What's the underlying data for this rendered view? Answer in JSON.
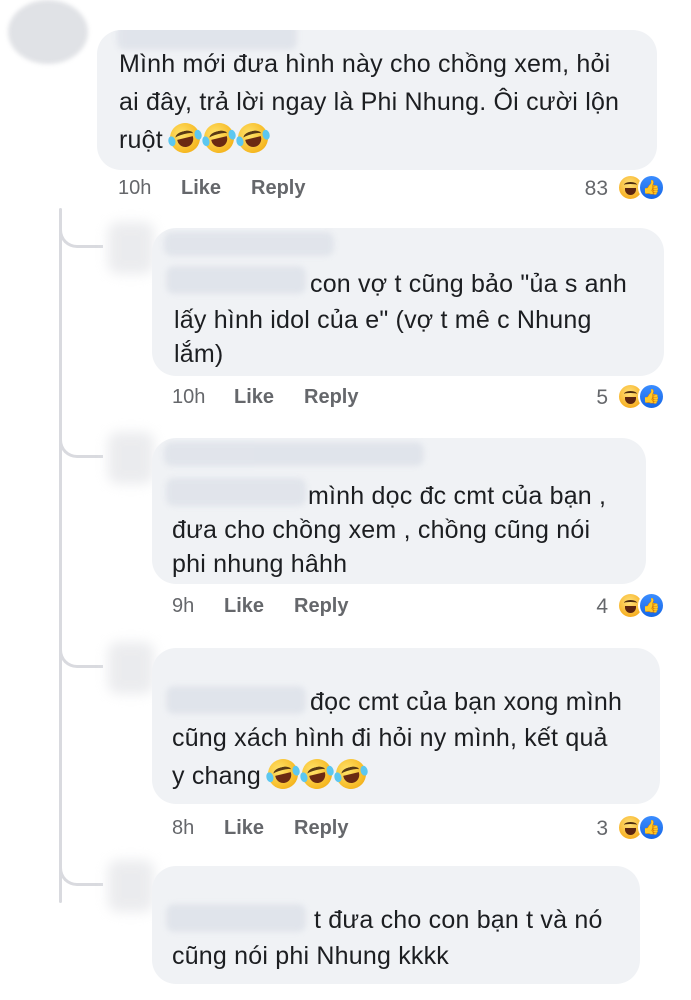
{
  "comments": [
    {
      "text_line_1": "Mình mới đưa hình này cho chồng xem, hỏi",
      "text_line_2": "ai đây, trả lời ngay là Phi Nhung. Ôi cười lộn",
      "text_line_3": "ruột",
      "emoji_icon": "rolling-on-floor-laughing-emoji",
      "emoji_count": 3,
      "time": "10h",
      "like_label": "Like",
      "reply_label": "Reply",
      "reaction_count": "83",
      "reaction_icons": [
        "haha-reaction-icon",
        "like-reaction-icon"
      ]
    },
    {
      "text_line_1": "con vợ t cũng bảo \"ủa s anh",
      "text_line_2": "lấy hình idol của e\" (vợ t mê c Nhung",
      "text_line_3": "lắm)",
      "time": "10h",
      "like_label": "Like",
      "reply_label": "Reply",
      "reaction_count": "5",
      "reaction_icons": [
        "haha-reaction-icon",
        "like-reaction-icon"
      ]
    },
    {
      "text_line_1": "mình dọc đc cmt của bạn ,",
      "text_line_2": "đưa cho chồng xem , chồng cũng nói",
      "text_line_3": "phi nhung hâhh",
      "time": "9h",
      "like_label": "Like",
      "reply_label": "Reply",
      "reaction_count": "4",
      "reaction_icons": [
        "haha-reaction-icon",
        "like-reaction-icon"
      ]
    },
    {
      "text_line_1": "đọc cmt của bạn xong mình",
      "text_line_2": "cũng xách hình đi hỏi ny mình, kết quả",
      "text_line_3": "y chang",
      "emoji_icon": "rolling-on-floor-laughing-emoji",
      "emoji_count": 3,
      "time": "8h",
      "like_label": "Like",
      "reply_label": "Reply",
      "reaction_count": "3",
      "reaction_icons": [
        "haha-reaction-icon",
        "like-reaction-icon"
      ]
    },
    {
      "text_line_1": "t đưa cho con bạn t và nó",
      "text_line_2": "cũng nói phi Nhung kkkk"
    }
  ],
  "colors": {
    "bubble_bg": "#f0f2f5",
    "meta_text": "#65676b",
    "like_blue": "#1877f2",
    "haha_yellow": "#f7b125"
  }
}
